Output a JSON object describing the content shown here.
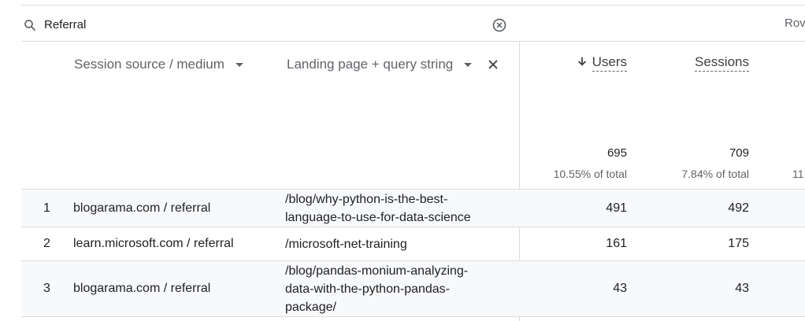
{
  "search": {
    "value": "Referral"
  },
  "rows_label": "Rov",
  "headers": {
    "dim1": "Session source / medium",
    "dim2": "Landing page + query string",
    "metrics": [
      "Users",
      "Sessions"
    ]
  },
  "totals": {
    "users": "695",
    "users_pct": "10.55% of total",
    "sessions": "709",
    "sessions_pct": "7.84% of total",
    "next_pct": "11"
  },
  "rows": [
    {
      "index": "1",
      "source": "blogarama.com / referral",
      "landing_lines": [
        "/blog/why-python-is-the-best-",
        "language-to-use-for-data-science"
      ],
      "users": "491",
      "sessions": "492"
    },
    {
      "index": "2",
      "source": "learn.microsoft.com / referral",
      "landing_lines": [
        "/microsoft-net-training"
      ],
      "users": "161",
      "sessions": "175"
    },
    {
      "index": "3",
      "source": "blogarama.com / referral",
      "landing_lines": [
        "/blog/pandas-monium-analyzing-",
        "data-with-the-python-pandas-",
        "package/"
      ],
      "users": "43",
      "sessions": "43"
    }
  ],
  "colors": {
    "divider": "#dadce0",
    "row_shade": "#f8f9fa",
    "muted_text": "#5f6368"
  },
  "icons": [
    "search-icon",
    "clear-icon",
    "chevron-down-icon",
    "close-icon",
    "arrow-down-icon"
  ]
}
